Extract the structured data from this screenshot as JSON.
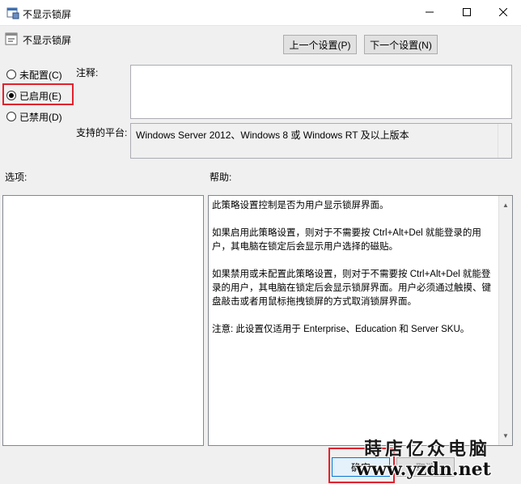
{
  "window": {
    "title": "不显示锁屏",
    "icon": "policy-icon",
    "controls": {
      "minimize": "minimize-icon",
      "maximize": "maximize-icon",
      "close": "close-icon"
    }
  },
  "header": {
    "setting_name": "不显示锁屏",
    "prev_label": "上一个设置(P)",
    "next_label": "下一个设置(N)"
  },
  "state": {
    "options": [
      {
        "label": "未配置(C)",
        "checked": false
      },
      {
        "label": "已启用(E)",
        "checked": true
      },
      {
        "label": "已禁用(D)",
        "checked": false
      }
    ],
    "highlight_color": "#e0222d"
  },
  "comment": {
    "label": "注释:",
    "value": ""
  },
  "platform": {
    "label": "支持的平台:",
    "value": "Windows Server 2012、Windows 8 或 Windows RT 及以上版本"
  },
  "options_pane": {
    "label": "选项:"
  },
  "help": {
    "label": "帮助:",
    "paragraphs": [
      "此策略设置控制是否为用户显示锁屏界面。",
      "如果启用此策略设置，则对于不需要按 Ctrl+Alt+Del 就能登录的用户，其电脑在锁定后会显示用户选择的磁贴。",
      "如果禁用或未配置此策略设置，则对于不需要按 Ctrl+Alt+Del 就能登录的用户，其电脑在锁定后会显示锁屏界面。用户必须通过触摸、键盘敲击或者用鼠标拖拽锁屏的方式取消锁屏界面。",
      "注意: 此设置仅适用于 Enterprise、Education 和 Server SKU。"
    ]
  },
  "footer": {
    "ok_label": "确定",
    "cancel_label": "取消"
  },
  "watermark": {
    "line1": "蒔店亿众电脑",
    "line2": "www.yzdn.net"
  }
}
